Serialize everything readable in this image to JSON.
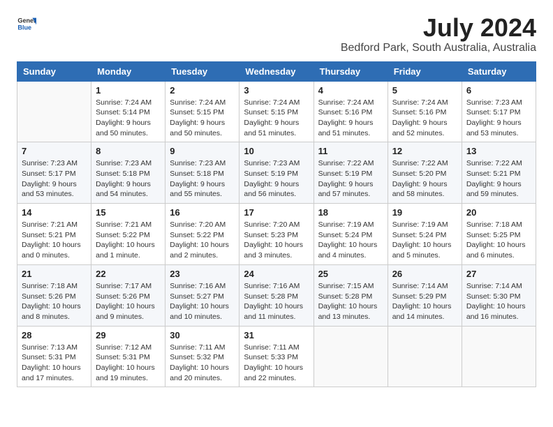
{
  "header": {
    "logo_general": "General",
    "logo_blue": "Blue",
    "title": "July 2024",
    "location": "Bedford Park, South Australia, Australia"
  },
  "calendar": {
    "columns": [
      "Sunday",
      "Monday",
      "Tuesday",
      "Wednesday",
      "Thursday",
      "Friday",
      "Saturday"
    ],
    "weeks": [
      [
        {
          "day": "",
          "sunrise": "",
          "sunset": "",
          "daylight": ""
        },
        {
          "day": "1",
          "sunrise": "Sunrise: 7:24 AM",
          "sunset": "Sunset: 5:14 PM",
          "daylight": "Daylight: 9 hours and 50 minutes."
        },
        {
          "day": "2",
          "sunrise": "Sunrise: 7:24 AM",
          "sunset": "Sunset: 5:15 PM",
          "daylight": "Daylight: 9 hours and 50 minutes."
        },
        {
          "day": "3",
          "sunrise": "Sunrise: 7:24 AM",
          "sunset": "Sunset: 5:15 PM",
          "daylight": "Daylight: 9 hours and 51 minutes."
        },
        {
          "day": "4",
          "sunrise": "Sunrise: 7:24 AM",
          "sunset": "Sunset: 5:16 PM",
          "daylight": "Daylight: 9 hours and 51 minutes."
        },
        {
          "day": "5",
          "sunrise": "Sunrise: 7:24 AM",
          "sunset": "Sunset: 5:16 PM",
          "daylight": "Daylight: 9 hours and 52 minutes."
        },
        {
          "day": "6",
          "sunrise": "Sunrise: 7:23 AM",
          "sunset": "Sunset: 5:17 PM",
          "daylight": "Daylight: 9 hours and 53 minutes."
        }
      ],
      [
        {
          "day": "7",
          "sunrise": "Sunrise: 7:23 AM",
          "sunset": "Sunset: 5:17 PM",
          "daylight": "Daylight: 9 hours and 53 minutes."
        },
        {
          "day": "8",
          "sunrise": "Sunrise: 7:23 AM",
          "sunset": "Sunset: 5:18 PM",
          "daylight": "Daylight: 9 hours and 54 minutes."
        },
        {
          "day": "9",
          "sunrise": "Sunrise: 7:23 AM",
          "sunset": "Sunset: 5:18 PM",
          "daylight": "Daylight: 9 hours and 55 minutes."
        },
        {
          "day": "10",
          "sunrise": "Sunrise: 7:23 AM",
          "sunset": "Sunset: 5:19 PM",
          "daylight": "Daylight: 9 hours and 56 minutes."
        },
        {
          "day": "11",
          "sunrise": "Sunrise: 7:22 AM",
          "sunset": "Sunset: 5:19 PM",
          "daylight": "Daylight: 9 hours and 57 minutes."
        },
        {
          "day": "12",
          "sunrise": "Sunrise: 7:22 AM",
          "sunset": "Sunset: 5:20 PM",
          "daylight": "Daylight: 9 hours and 58 minutes."
        },
        {
          "day": "13",
          "sunrise": "Sunrise: 7:22 AM",
          "sunset": "Sunset: 5:21 PM",
          "daylight": "Daylight: 9 hours and 59 minutes."
        }
      ],
      [
        {
          "day": "14",
          "sunrise": "Sunrise: 7:21 AM",
          "sunset": "Sunset: 5:21 PM",
          "daylight": "Daylight: 10 hours and 0 minutes."
        },
        {
          "day": "15",
          "sunrise": "Sunrise: 7:21 AM",
          "sunset": "Sunset: 5:22 PM",
          "daylight": "Daylight: 10 hours and 1 minute."
        },
        {
          "day": "16",
          "sunrise": "Sunrise: 7:20 AM",
          "sunset": "Sunset: 5:22 PM",
          "daylight": "Daylight: 10 hours and 2 minutes."
        },
        {
          "day": "17",
          "sunrise": "Sunrise: 7:20 AM",
          "sunset": "Sunset: 5:23 PM",
          "daylight": "Daylight: 10 hours and 3 minutes."
        },
        {
          "day": "18",
          "sunrise": "Sunrise: 7:19 AM",
          "sunset": "Sunset: 5:24 PM",
          "daylight": "Daylight: 10 hours and 4 minutes."
        },
        {
          "day": "19",
          "sunrise": "Sunrise: 7:19 AM",
          "sunset": "Sunset: 5:24 PM",
          "daylight": "Daylight: 10 hours and 5 minutes."
        },
        {
          "day": "20",
          "sunrise": "Sunrise: 7:18 AM",
          "sunset": "Sunset: 5:25 PM",
          "daylight": "Daylight: 10 hours and 6 minutes."
        }
      ],
      [
        {
          "day": "21",
          "sunrise": "Sunrise: 7:18 AM",
          "sunset": "Sunset: 5:26 PM",
          "daylight": "Daylight: 10 hours and 8 minutes."
        },
        {
          "day": "22",
          "sunrise": "Sunrise: 7:17 AM",
          "sunset": "Sunset: 5:26 PM",
          "daylight": "Daylight: 10 hours and 9 minutes."
        },
        {
          "day": "23",
          "sunrise": "Sunrise: 7:16 AM",
          "sunset": "Sunset: 5:27 PM",
          "daylight": "Daylight: 10 hours and 10 minutes."
        },
        {
          "day": "24",
          "sunrise": "Sunrise: 7:16 AM",
          "sunset": "Sunset: 5:28 PM",
          "daylight": "Daylight: 10 hours and 11 minutes."
        },
        {
          "day": "25",
          "sunrise": "Sunrise: 7:15 AM",
          "sunset": "Sunset: 5:28 PM",
          "daylight": "Daylight: 10 hours and 13 minutes."
        },
        {
          "day": "26",
          "sunrise": "Sunrise: 7:14 AM",
          "sunset": "Sunset: 5:29 PM",
          "daylight": "Daylight: 10 hours and 14 minutes."
        },
        {
          "day": "27",
          "sunrise": "Sunrise: 7:14 AM",
          "sunset": "Sunset: 5:30 PM",
          "daylight": "Daylight: 10 hours and 16 minutes."
        }
      ],
      [
        {
          "day": "28",
          "sunrise": "Sunrise: 7:13 AM",
          "sunset": "Sunset: 5:31 PM",
          "daylight": "Daylight: 10 hours and 17 minutes."
        },
        {
          "day": "29",
          "sunrise": "Sunrise: 7:12 AM",
          "sunset": "Sunset: 5:31 PM",
          "daylight": "Daylight: 10 hours and 19 minutes."
        },
        {
          "day": "30",
          "sunrise": "Sunrise: 7:11 AM",
          "sunset": "Sunset: 5:32 PM",
          "daylight": "Daylight: 10 hours and 20 minutes."
        },
        {
          "day": "31",
          "sunrise": "Sunrise: 7:11 AM",
          "sunset": "Sunset: 5:33 PM",
          "daylight": "Daylight: 10 hours and 22 minutes."
        },
        {
          "day": "",
          "sunrise": "",
          "sunset": "",
          "daylight": ""
        },
        {
          "day": "",
          "sunrise": "",
          "sunset": "",
          "daylight": ""
        },
        {
          "day": "",
          "sunrise": "",
          "sunset": "",
          "daylight": ""
        }
      ]
    ]
  }
}
